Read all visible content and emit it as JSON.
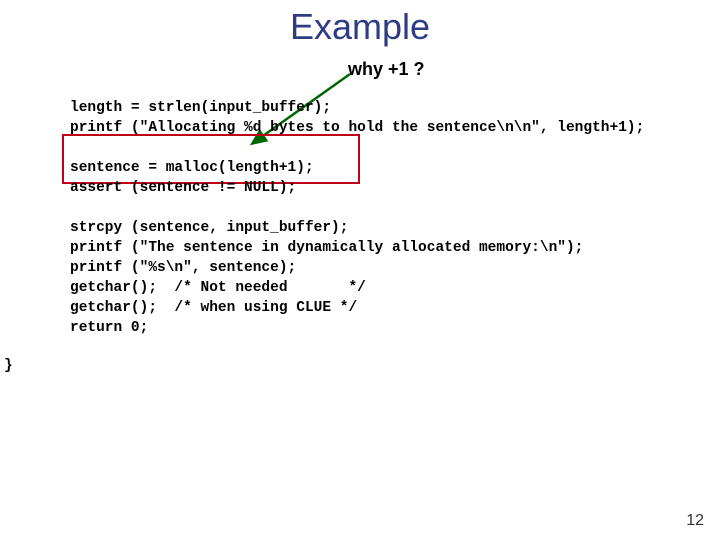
{
  "title": "Example",
  "annotation": "why +1 ?",
  "code": {
    "l1": "length = strlen(input_buffer);",
    "l2": "printf (\"Allocating %d bytes to hold the sentence\\n\\n\", length+1);",
    "l3": "",
    "l4": "sentence = malloc(length+1);",
    "l5": "assert (sentence != NULL);",
    "l6": "",
    "l7": "strcpy (sentence, input_buffer);",
    "l8": "printf (\"The sentence in dynamically allocated memory:\\n\");",
    "l9": "printf (\"%s\\n\", sentence);",
    "l10": "getchar();  /* Not needed       */",
    "l11": "getchar();  /* when using CLUE */",
    "l12": "return 0;"
  },
  "closebrace": "}",
  "pagenum": "12"
}
